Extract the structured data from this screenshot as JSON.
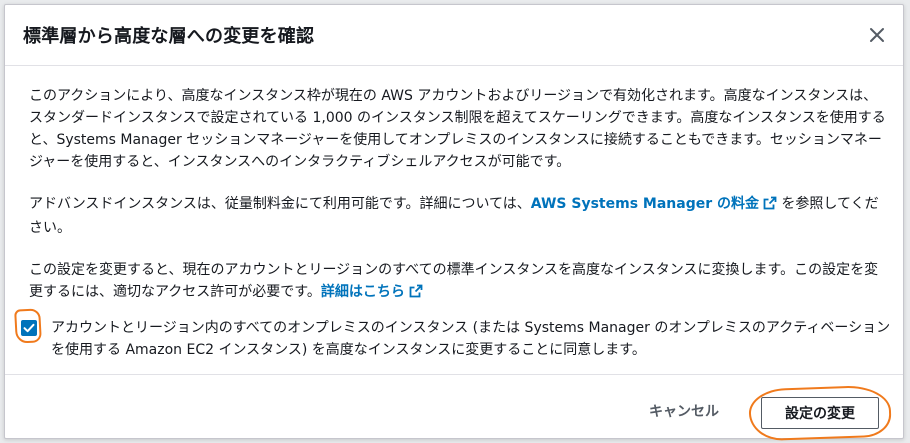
{
  "dialog": {
    "title": "標準層から高度な層への変更を確認",
    "close_icon": "close-icon"
  },
  "body": {
    "paragraph1": "このアクションにより、高度なインスタンス枠が現在の AWS アカウントおよびリージョンで有効化されます。高度なインスタンスは、スタンダードインスタンスで設定されている 1,000 のインスタンス制限を超えてスケーリングできます。高度なインスタンスを使用すると、Systems Manager セッションマネージャーを使用してオンプレミスのインスタンスに接続することもできます。セッションマネージャーを使用すると、インスタンスへのインタラクティブシェルアクセスが可能です。",
    "paragraph2_before": "アドバンスドインスタンスは、従量制料金にて利用可能です。詳細については、",
    "paragraph2_link": "AWS Systems Manager の料金",
    "paragraph2_after": " を参照してください。",
    "paragraph3_before": "この設定を変更すると、現在のアカウントとリージョンのすべての標準インスタンスを高度なインスタンスに変換します。この設定を変更するには、適切なアクセス許可が必要です。",
    "paragraph3_link": "詳細はこちら",
    "external_link_icon": "external-link-icon"
  },
  "consent": {
    "checked": true,
    "label": "アカウントとリージョン内のすべてのオンプレミスのインスタンス (または Systems Manager のオンプレミスのアクティベーションを使用する Amazon EC2 インスタンス) を高度なインスタンスに変更することに同意します。"
  },
  "footer": {
    "cancel_label": "キャンセル",
    "apply_label": "設定の変更"
  },
  "colors": {
    "link": "#0073bb",
    "checkbox": "#0073bb",
    "annotation": "#f07a1c",
    "text": "#16191f"
  }
}
